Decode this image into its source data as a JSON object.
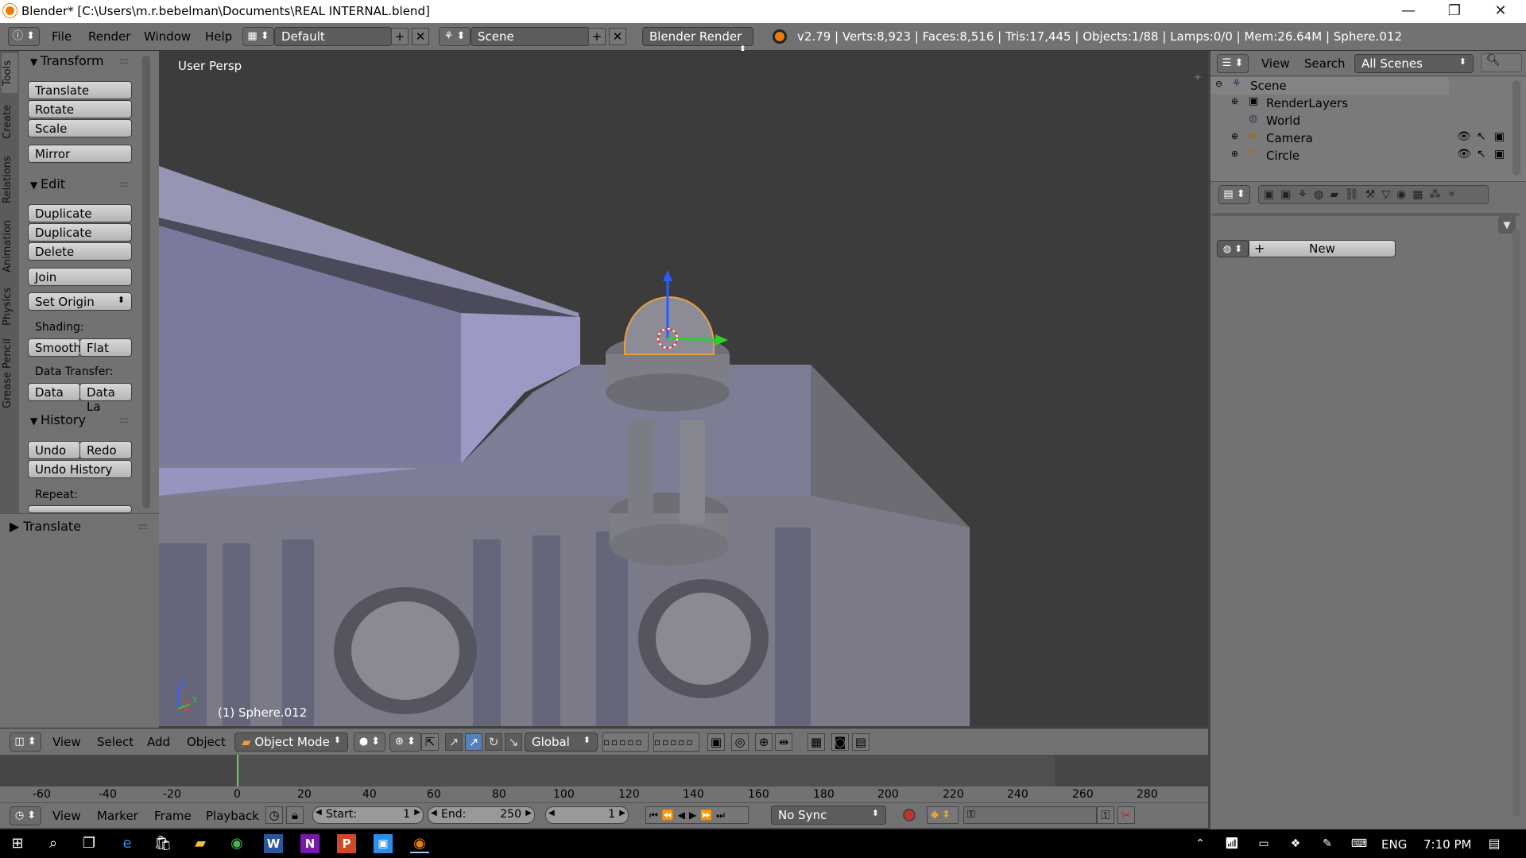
{
  "titlebar": {
    "title": "Blender* [C:\\Users\\m.r.bebelman\\Documents\\REAL INTERNAL.blend]",
    "minimize": "—",
    "restore": "❐",
    "close": "✕"
  },
  "infobar": {
    "menus": [
      "File",
      "Render",
      "Window",
      "Help"
    ],
    "layout": "Default",
    "scene": "Scene",
    "engine": "Blender Render",
    "stats": "v2.79 | Verts:8,923 | Faces:8,516 | Tris:17,445 | Objects:1/88 | Lamps:0/0 | Mem:26.64M | Sphere.012",
    "add_glyph": "+",
    "remove_glyph": "✕"
  },
  "left_tabs": [
    "Tools",
    "Create",
    "Relations",
    "Animation",
    "Physics",
    "Grease Pencil"
  ],
  "toolshelf": {
    "transform_title": "Transform",
    "translate": "Translate",
    "rotate": "Rotate",
    "scale": "Scale",
    "mirror": "Mirror",
    "edit_title": "Edit",
    "duplicate": "Duplicate",
    "duplicate_linked": "Duplicate Linked",
    "delete": "Delete",
    "join": "Join",
    "set_origin": "Set Origin",
    "shading_label": "Shading:",
    "smooth": "Smooth",
    "flat": "Flat",
    "data_transfer_label": "Data Transfer:",
    "data": "Data",
    "data_la": "Data La",
    "history_title": "History",
    "undo": "Undo",
    "redo": "Redo",
    "undo_history": "Undo History",
    "repeat_label": "Repeat:",
    "operator_title": "Translate"
  },
  "viewport": {
    "persp_label": "User Persp",
    "object_label": "(1) Sphere.012",
    "axis_z": "Z",
    "axis_x": "X",
    "axis_y": "Y"
  },
  "outliner": {
    "view": "View",
    "search": "Search",
    "filter": "All Scenes",
    "items": [
      "Scene",
      "RenderLayers",
      "World",
      "Camera",
      "Circle"
    ]
  },
  "properties": {
    "new_button": "New"
  },
  "viewport_header": {
    "menus": [
      "View",
      "Select",
      "Add",
      "Object"
    ],
    "mode": "Object Mode",
    "orientation": "Global"
  },
  "timeline": {
    "ticks": [
      "-60",
      "-40",
      "-20",
      "0",
      "20",
      "40",
      "60",
      "80",
      "100",
      "120",
      "140",
      "160",
      "180",
      "200",
      "220",
      "240",
      "260",
      "280"
    ],
    "menus": [
      "View",
      "Marker",
      "Frame",
      "Playback"
    ],
    "start_label": "Start:",
    "start_value": "1",
    "end_label": "End:",
    "end_value": "250",
    "current_frame": "1",
    "sync": "No Sync"
  },
  "taskbar": {
    "language": "ENG",
    "time": "7:10 PM"
  },
  "colors": {
    "accent": "#e87d0d",
    "panel": "#727272",
    "viewport_bg": "#3c3c3c"
  }
}
